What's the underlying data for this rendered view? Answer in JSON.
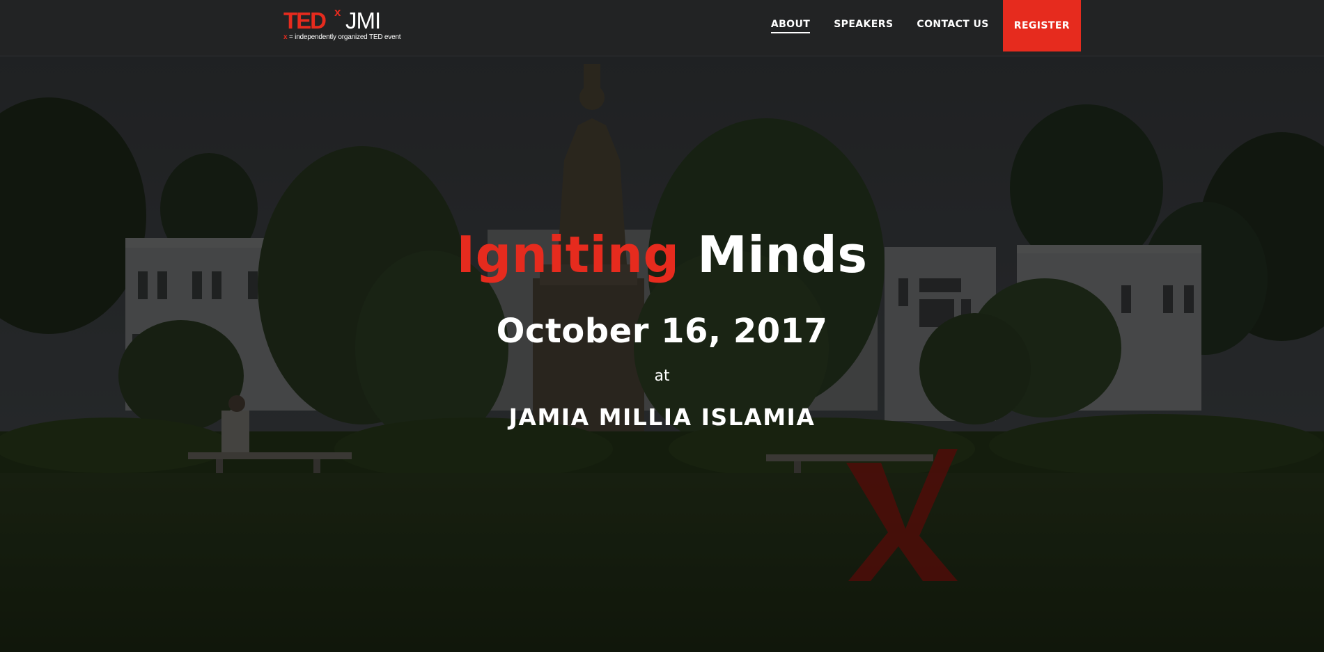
{
  "brand": {
    "ted": "TED",
    "x": "x",
    "name": "JMI",
    "tagline_x": "x",
    "tagline": " = independently organized TED event"
  },
  "nav": {
    "items": [
      {
        "label": "ABOUT",
        "active": true
      },
      {
        "label": "SPEAKERS",
        "active": false
      },
      {
        "label": "CONTACT US",
        "active": false
      }
    ],
    "register_label": "REGISTER"
  },
  "hero": {
    "headline_accent": "Igniting",
    "headline_rest": "Minds",
    "date": "October 16, 2017",
    "at": "at",
    "venue": "JAMIA MILLIA ISLAMIA",
    "background": "campus-scene-image"
  },
  "colors": {
    "accent": "#e62b1e",
    "navbar": "#222324",
    "text": "#ffffff"
  }
}
